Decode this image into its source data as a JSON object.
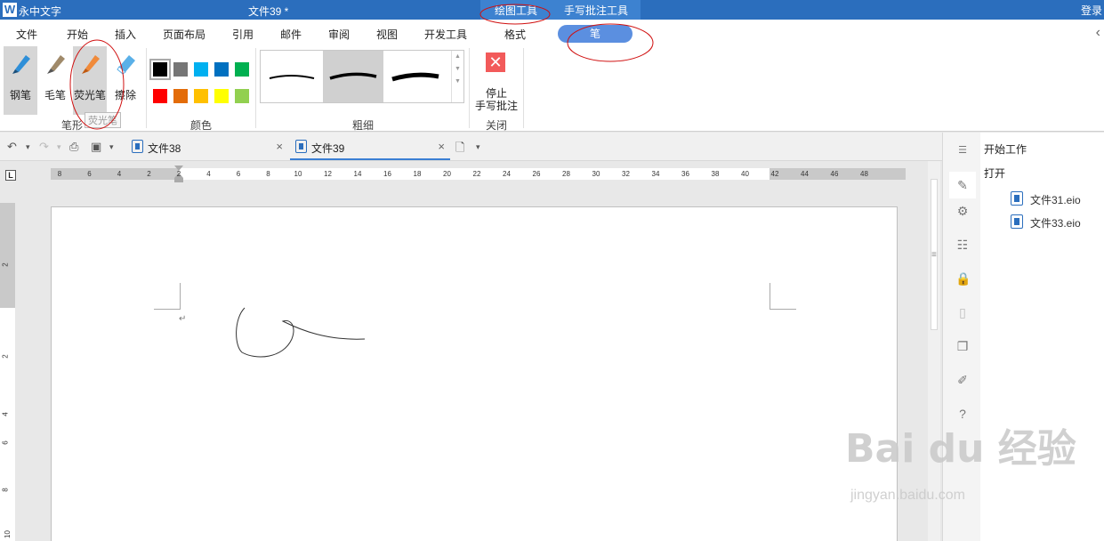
{
  "titlebar": {
    "logo": "W",
    "app_name": "永中文字",
    "doc_title": "文件39 *",
    "context_tab_drawing": "绘图工具",
    "context_tab_handwriting": "手写批注工具",
    "login": "登录"
  },
  "menu": {
    "items": [
      "文件",
      "开始",
      "插入",
      "页面布局",
      "引用",
      "邮件",
      "审阅",
      "视图",
      "开发工具",
      "格式"
    ],
    "active_pill": "笔"
  },
  "ribbon": {
    "pen_types": [
      {
        "label": "钢笔",
        "icon": "fountain-pen-icon",
        "active": true
      },
      {
        "label": "毛笔",
        "icon": "brush-pen-icon",
        "active": false
      },
      {
        "label": "荧光笔",
        "icon": "highlighter-icon",
        "active": false
      },
      {
        "label": "擦除",
        "icon": "eraser-icon",
        "active": false
      }
    ],
    "tooltip": "荧光笔",
    "group_pen_shape": "笔形",
    "group_color": "颜色",
    "group_thickness": "粗细",
    "group_close": "关闭",
    "colors": [
      "#000000",
      "#767676",
      "#00b0f0",
      "#0070c0",
      "#00b050",
      "#ff0000",
      "#e36c09",
      "#ffc000",
      "#ffff00",
      "#92d050"
    ],
    "selected_color": "#000000",
    "stop_line1": "停止",
    "stop_line2": "手写批注"
  },
  "tabs": {
    "items": [
      {
        "name": "文件38",
        "active": false
      },
      {
        "name": "文件39",
        "active": true
      }
    ],
    "close_glyph": "×"
  },
  "ruler": {
    "corner": "L",
    "h_ticks": [
      "8",
      "6",
      "4",
      "2",
      "2",
      "4",
      "6",
      "8",
      "10",
      "12",
      "14",
      "16",
      "18",
      "20",
      "22",
      "24",
      "26",
      "28",
      "30",
      "32",
      "34",
      "36",
      "38",
      "40",
      "42",
      "44",
      "46",
      "48"
    ],
    "v_ticks": [
      "2",
      "2",
      "4",
      "6",
      "8",
      "10"
    ]
  },
  "right_panel": {
    "header": "开始工作",
    "open_label": "打开",
    "files": [
      "文件31.eio",
      "文件33.eio"
    ]
  },
  "watermark": {
    "brand": "Bai du 经验",
    "url": "jingyan.baidu.com"
  }
}
